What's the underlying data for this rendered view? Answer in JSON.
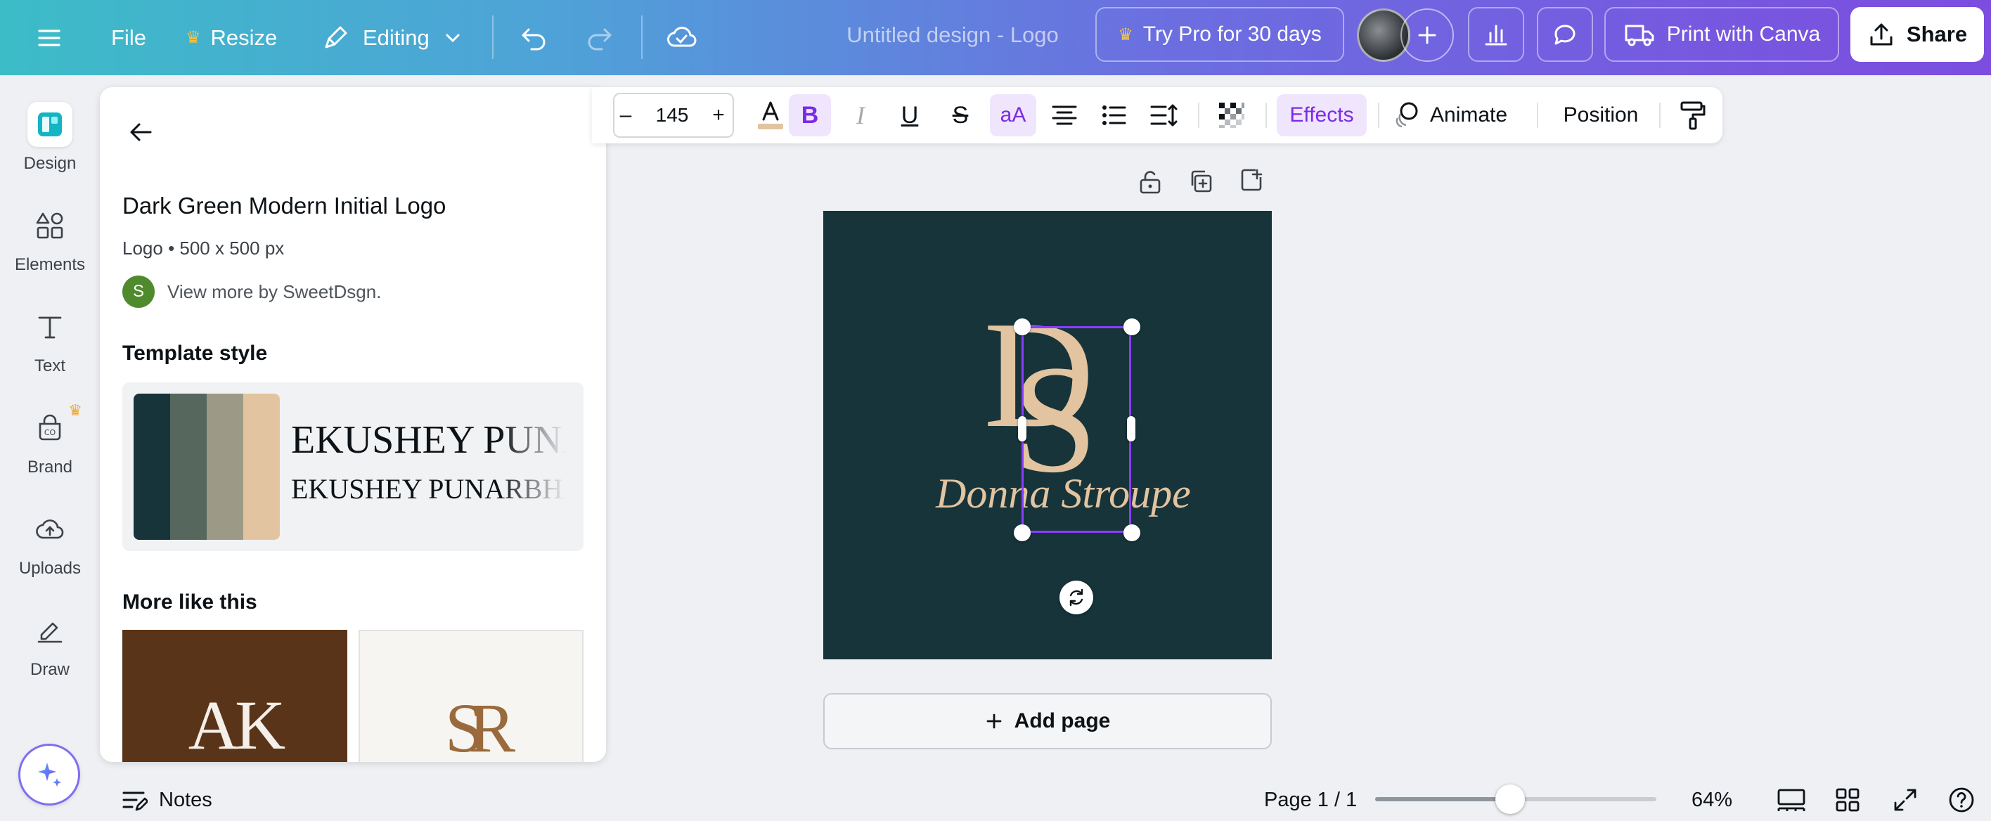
{
  "topbar": {
    "file_label": "File",
    "resize_label": "Resize",
    "editing_label": "Editing",
    "design_title": "Untitled design - Logo",
    "try_pro_label": "Try Pro for 30 days",
    "print_label": "Print with Canva",
    "share_label": "Share"
  },
  "rail": {
    "items": [
      {
        "label": "Design"
      },
      {
        "label": "Elements"
      },
      {
        "label": "Text"
      },
      {
        "label": "Brand"
      },
      {
        "label": "Uploads"
      },
      {
        "label": "Draw"
      }
    ]
  },
  "panel": {
    "template_name": "Dark Green Modern Initial Logo",
    "template_meta": "Logo • 500 x 500 px",
    "author_initial": "S",
    "author_link": "View more by SweetDsgn.",
    "style_heading": "Template style",
    "font_sample_heading": "EKUSHEY PUNARBHAB",
    "font_sample_body": "EKUSHEY PUNARBHAB",
    "more_heading": "More like this",
    "thumbs": [
      {
        "monogram": "AK"
      },
      {
        "monogram": "SR"
      }
    ],
    "palette": [
      "#16343a",
      "#56675e",
      "#9c9a86",
      "#e2c4a0"
    ]
  },
  "text_toolbar": {
    "font_size": "145",
    "decrease": "–",
    "increase": "+",
    "case_label": "aA",
    "effects_label": "Effects",
    "animate_label": "Animate",
    "position_label": "Position"
  },
  "canvas": {
    "monogram_left": "D",
    "monogram_right": "S",
    "script_name": "Donna Stroupe",
    "background": "#16343a",
    "ink": "#e2c4a0"
  },
  "add_page_label": "Add page",
  "bottom": {
    "notes_label": "Notes",
    "page_label": "Page 1 / 1",
    "zoom_label": "64%",
    "zoom_fraction": 0.48
  },
  "colors": {
    "accent_purple": "#7d2ae8",
    "selection": "#8b3dff"
  }
}
